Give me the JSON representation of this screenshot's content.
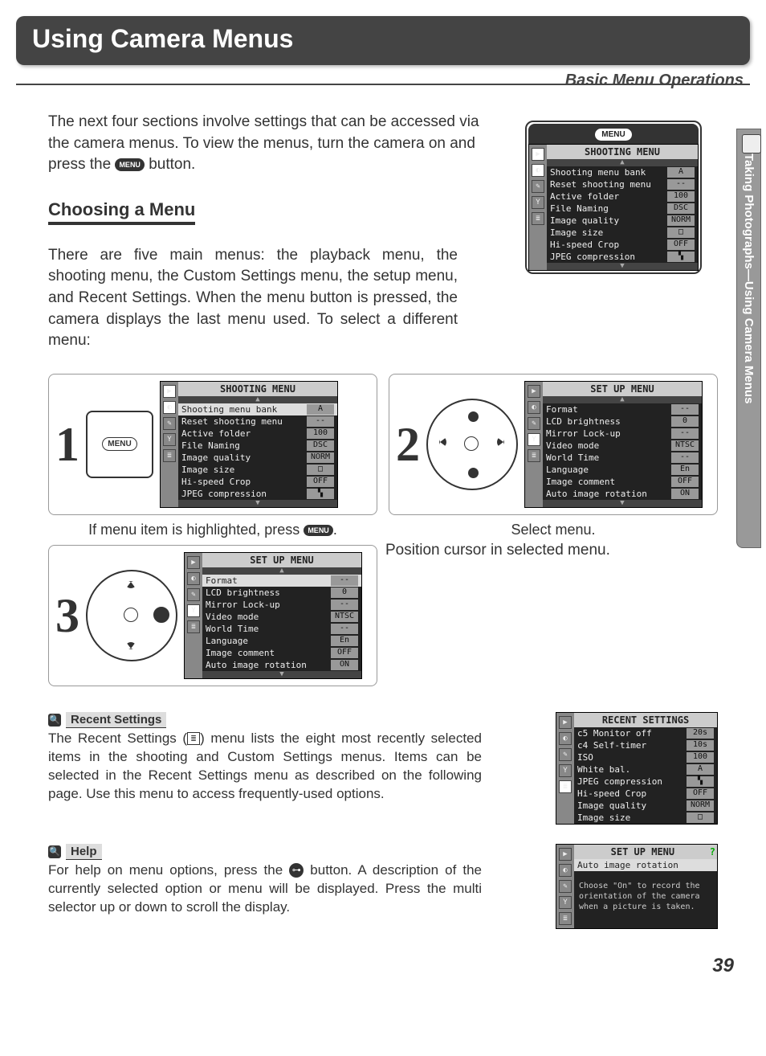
{
  "page": {
    "title": "Using Camera Menus",
    "subtitle": "Basic Menu Operations",
    "side_tab": "Taking Photographs—Using Camera Menus",
    "number": "39"
  },
  "intro": "The next four sections involve settings that can be accessed via the camera menus.  To view the menus, turn the camera on and press the ",
  "intro_after": " button.",
  "menu_label": "MENU",
  "choosing": {
    "heading": "Choosing a Menu",
    "para": "There are five main menus: the playback menu, the shooting menu, the Custom Settings menu, the setup menu, and Recent Settings.  When the menu button is pressed, the camera displays the last menu used.  To select a different menu:"
  },
  "top_lcd": {
    "title": "SHOOTING MENU",
    "rows": [
      {
        "l": "Shooting menu bank",
        "v": "A"
      },
      {
        "l": "Reset shooting menu",
        "v": "--"
      },
      {
        "l": "Active folder",
        "v": "100"
      },
      {
        "l": "File Naming",
        "v": "DSC"
      },
      {
        "l": "Image quality",
        "v": "NORM"
      },
      {
        "l": "Image size",
        "v": "□"
      },
      {
        "l": "Hi-speed Crop",
        "v": "OFF"
      },
      {
        "l": "JPEG compression",
        "v": "▚"
      }
    ]
  },
  "steps": {
    "s1": {
      "num": "1",
      "caption_a": "If menu item is highlighted, press ",
      "caption_b": ".",
      "lcd_title": "SHOOTING MENU",
      "rows": [
        {
          "l": "Shooting menu bank",
          "v": "A",
          "sel": true
        },
        {
          "l": "Reset shooting menu",
          "v": "--"
        },
        {
          "l": "Active folder",
          "v": "100"
        },
        {
          "l": "File Naming",
          "v": "DSC"
        },
        {
          "l": "Image quality",
          "v": "NORM"
        },
        {
          "l": "Image size",
          "v": "□"
        },
        {
          "l": "Hi-speed Crop",
          "v": "OFF"
        },
        {
          "l": "JPEG compression",
          "v": "▚"
        }
      ]
    },
    "s2": {
      "num": "2",
      "caption": "Select menu.",
      "lcd_title": "SET UP MENU",
      "rows": [
        {
          "l": "Format",
          "v": "--"
        },
        {
          "l": "LCD brightness",
          "v": "0"
        },
        {
          "l": "Mirror Lock-up",
          "v": "--"
        },
        {
          "l": "Video mode",
          "v": "NTSC"
        },
        {
          "l": "World Time",
          "v": "--"
        },
        {
          "l": "Language",
          "v": "En"
        },
        {
          "l": "Image comment",
          "v": "OFF"
        },
        {
          "l": "Auto image rotation",
          "v": "ON"
        }
      ]
    },
    "s3": {
      "num": "3",
      "caption": "Position cursor in selected menu.",
      "lcd_title": "SET UP MENU",
      "rows": [
        {
          "l": "Format",
          "v": "--",
          "sel": true
        },
        {
          "l": "LCD brightness",
          "v": "0"
        },
        {
          "l": "Mirror Lock-up",
          "v": "--"
        },
        {
          "l": "Video mode",
          "v": "NTSC"
        },
        {
          "l": "World Time",
          "v": "--"
        },
        {
          "l": "Language",
          "v": "En"
        },
        {
          "l": "Image comment",
          "v": "OFF"
        },
        {
          "l": "Auto image rotation",
          "v": "ON"
        }
      ]
    }
  },
  "recent": {
    "label": "Recent Settings",
    "para_a": "The Recent Settings (",
    "para_b": ") menu lists the eight most recently selected items in the shooting and Custom Settings menus.  Items can be selected in the Recent Settings menu as described on the following page.  Use this menu to access frequently-used options.",
    "lcd_title": "RECENT SETTINGS",
    "rows": [
      {
        "l": "c5 Monitor off",
        "v": "20s"
      },
      {
        "l": "c4 Self-timer",
        "v": "10s"
      },
      {
        "l": "ISO",
        "v": "100"
      },
      {
        "l": "White bal.",
        "v": "A"
      },
      {
        "l": "JPEG compression",
        "v": "▚"
      },
      {
        "l": "Hi-speed Crop",
        "v": "OFF"
      },
      {
        "l": "Image quality",
        "v": "NORM"
      },
      {
        "l": "Image size",
        "v": "□"
      }
    ]
  },
  "help": {
    "label": "Help",
    "para_a": "For help on menu options, press the ",
    "para_b": " button.  A description of the currently selected option or menu will be displayed.  Press the multi selector up or down to scroll the display.",
    "lcd_title": "SET UP MENU",
    "sel": "Auto image rotation",
    "text": "Choose \"On\" to record the orientation of the camera when a picture is taken."
  }
}
